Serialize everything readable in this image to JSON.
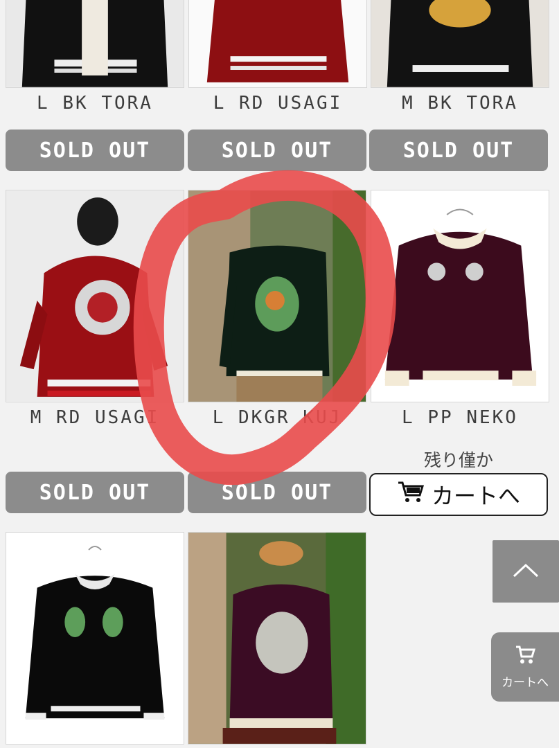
{
  "products": [
    {
      "name": "L BK TORA",
      "button": "SOLD OUT"
    },
    {
      "name": "L RD USAGI",
      "button": "SOLD OUT"
    },
    {
      "name": "M BK TORA",
      "button": "SOLD OUT"
    },
    {
      "name": "M RD USAGI",
      "button": "SOLD OUT"
    },
    {
      "name": "L DKGR KUJ",
      "button": "SOLD OUT"
    },
    {
      "name": "L PP NEKO",
      "stock_note": "残り僅か",
      "button": "カートへ"
    }
  ],
  "floating": {
    "cart_label": "カートへ"
  },
  "colors": {
    "sold_out_bg": "#8c8c8c",
    "annotation": "#e94b4b",
    "page_bg": "#f2f2f2"
  }
}
